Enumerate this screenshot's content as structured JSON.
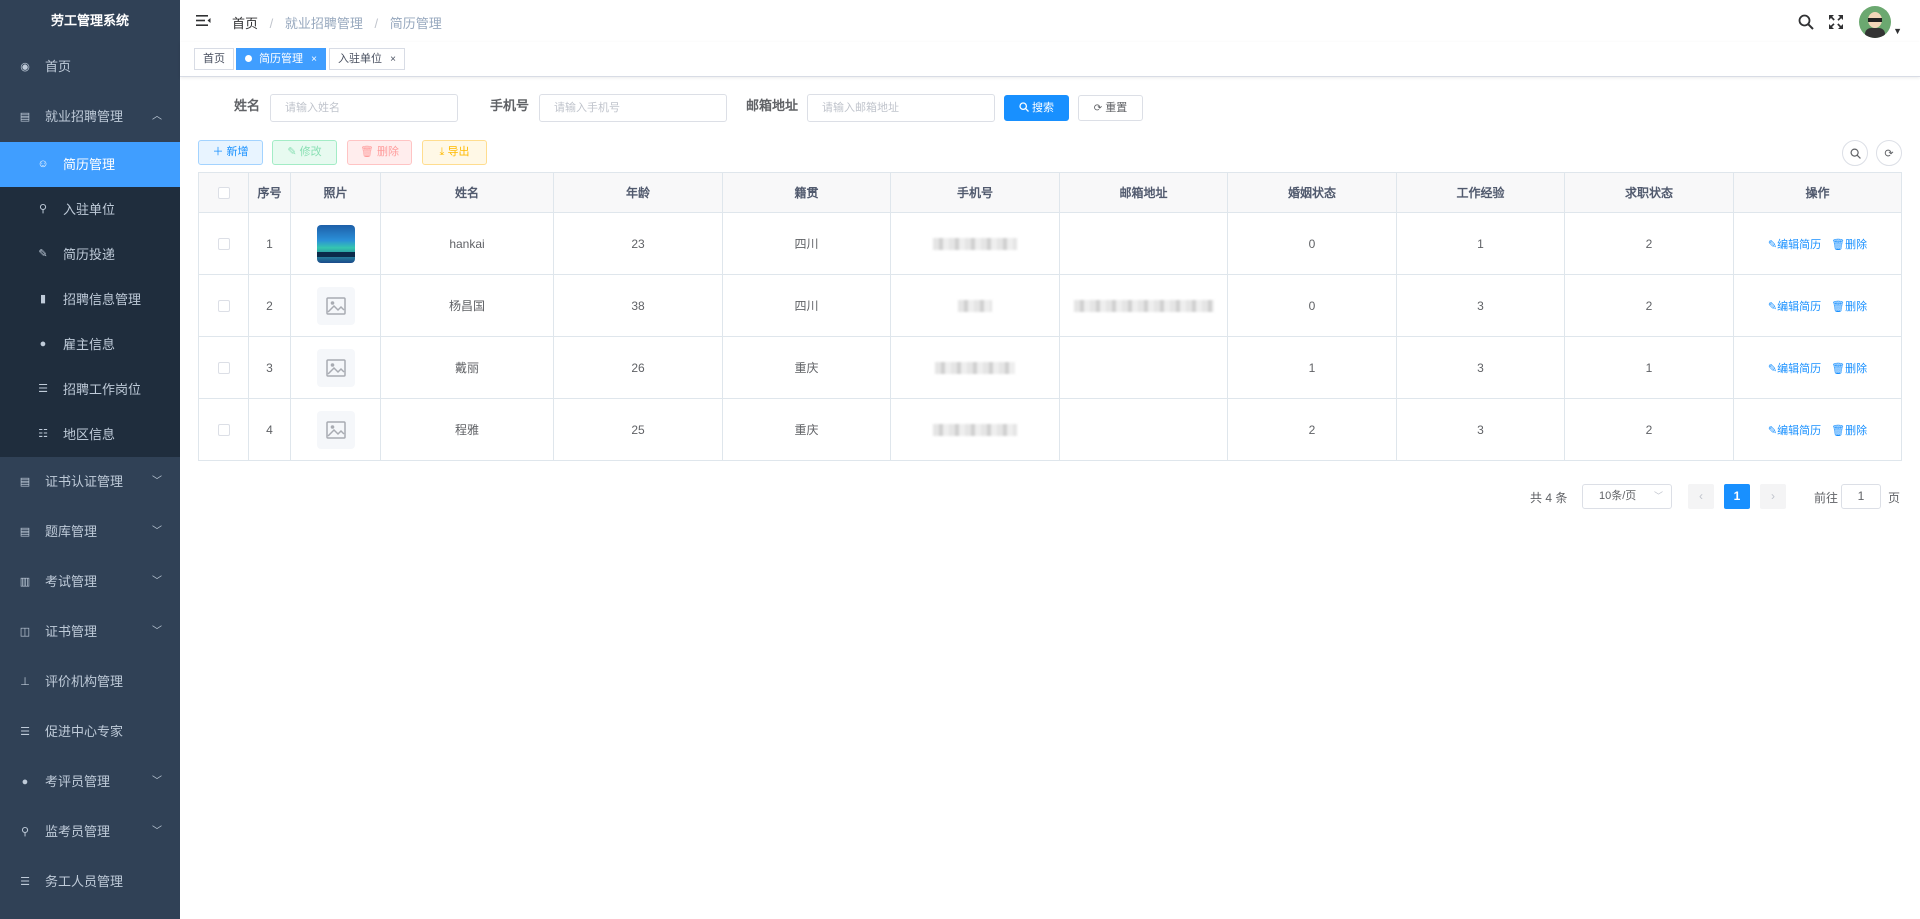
{
  "app": {
    "title": "劳工管理系统"
  },
  "sidebar": {
    "items": [
      {
        "label": "首页",
        "icon": "dashboard-icon",
        "glyph": "◉"
      },
      {
        "label": "就业招聘管理",
        "icon": "document-icon",
        "glyph": "▤",
        "arrow": "︿"
      },
      {
        "label": "证书认证管理",
        "icon": "document-icon",
        "glyph": "▤",
        "arrow": "﹀"
      },
      {
        "label": "题库管理",
        "icon": "document-icon",
        "glyph": "▤",
        "arrow": "﹀"
      },
      {
        "label": "考试管理",
        "icon": "book-icon",
        "glyph": "▥",
        "arrow": "﹀"
      },
      {
        "label": "证书管理",
        "icon": "book-open-icon",
        "glyph": "◫",
        "arrow": "﹀"
      },
      {
        "label": "评价机构管理",
        "icon": "tree-icon",
        "glyph": "⊥"
      },
      {
        "label": "促进中心专家",
        "icon": "list-icon",
        "glyph": "☰"
      },
      {
        "label": "考评员管理",
        "icon": "user-icon",
        "glyph": "●",
        "arrow": "﹀"
      },
      {
        "label": "监考员管理",
        "icon": "tool-icon",
        "glyph": "⚲",
        "arrow": "﹀"
      },
      {
        "label": "务工人员管理",
        "icon": "list-icon",
        "glyph": "☰"
      }
    ],
    "submenu": [
      {
        "label": "简历管理",
        "icon": "peoples-icon",
        "glyph": "☺",
        "active": true
      },
      {
        "label": "入驻单位",
        "icon": "tool-icon",
        "glyph": "⚲"
      },
      {
        "label": "简历投递",
        "icon": "edit-icon",
        "glyph": "✎"
      },
      {
        "label": "招聘信息管理",
        "icon": "info-icon",
        "glyph": "▮"
      },
      {
        "label": "雇主信息",
        "icon": "user-icon",
        "glyph": "●"
      },
      {
        "label": "招聘工作岗位",
        "icon": "list-icon",
        "glyph": "☰"
      },
      {
        "label": "地区信息",
        "icon": "tree-table-icon",
        "glyph": "☷"
      }
    ]
  },
  "breadcrumb": {
    "home": "首页",
    "sep": "/",
    "level1": "就业招聘管理",
    "level2": "简历管理"
  },
  "tags": [
    {
      "label": "首页"
    },
    {
      "label": "简历管理",
      "close": "×"
    },
    {
      "label": "入驻单位",
      "close": "×"
    }
  ],
  "search": {
    "name_label": "姓名",
    "name_placeholder": "请输入姓名",
    "phone_label": "手机号",
    "phone_placeholder": "请输入手机号",
    "email_label": "邮箱地址",
    "email_placeholder": "请输入邮箱地址",
    "search_btn": "搜索",
    "reset_btn": "重置"
  },
  "toolbar": {
    "add": "新增",
    "edit": "修改",
    "delete": "删除",
    "export": "导出"
  },
  "table": {
    "headers": [
      "序号",
      "照片",
      "姓名",
      "年龄",
      "籍贯",
      "手机号",
      "邮箱地址",
      "婚姻状态",
      "工作经验",
      "求职状态",
      "操作"
    ],
    "rows": [
      {
        "index": "1",
        "photo": "image",
        "name": "hankai",
        "age": "23",
        "origin": "四川",
        "marital": "0",
        "experience": "1",
        "status": "2"
      },
      {
        "index": "2",
        "photo": "placeholder",
        "name": "杨昌国",
        "age": "38",
        "origin": "四川",
        "marital": "0",
        "experience": "3",
        "status": "2"
      },
      {
        "index": "3",
        "photo": "placeholder",
        "name": "戴丽",
        "age": "26",
        "origin": "重庆",
        "marital": "1",
        "experience": "3",
        "status": "1"
      },
      {
        "index": "4",
        "photo": "placeholder",
        "name": "程雅",
        "age": "25",
        "origin": "重庆",
        "marital": "2",
        "experience": "3",
        "status": "2"
      }
    ],
    "edit_link": "编辑简历",
    "delete_link": "删除"
  },
  "pagination": {
    "total": "共 4 条",
    "page_size": "10条/页",
    "current": "1",
    "goto_label": "前往",
    "goto_value": "1",
    "unit": "页"
  },
  "colors": {
    "sidebar_bg": "#304156",
    "submenu_bg": "#1f2d3d",
    "primary": "#1890ff",
    "active_menu": "#409eff"
  }
}
